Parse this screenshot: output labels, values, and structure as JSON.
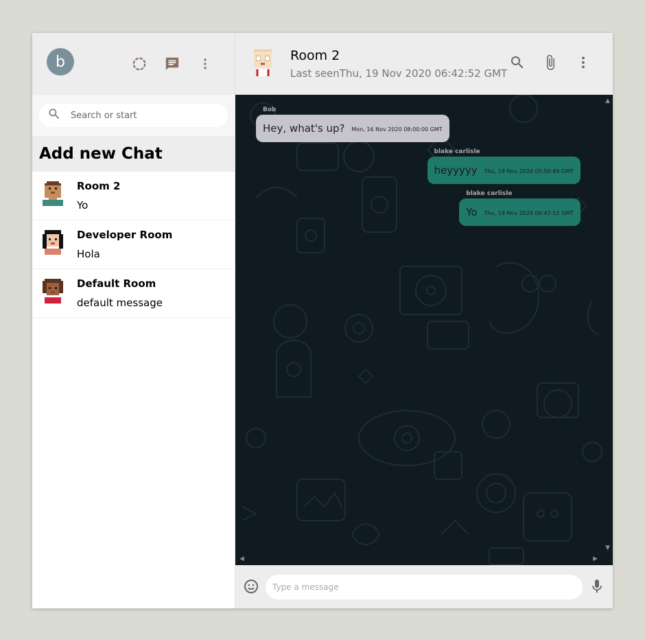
{
  "user": {
    "avatar_letter": "b"
  },
  "sidebar": {
    "search_placeholder": "Search or start",
    "add_chat_label": "Add new Chat",
    "chats": [
      {
        "name": "Room 2",
        "last": "Yo"
      },
      {
        "name": "Developer Room",
        "last": "Hola"
      },
      {
        "name": "Default Room",
        "last": "default message"
      }
    ]
  },
  "chat": {
    "title": "Room 2",
    "last_seen": "Last seenThu, 19 Nov 2020 06:42:52 GMT",
    "messages": [
      {
        "name": "Bob",
        "text": "Hey, what's up?",
        "time": "Mon, 16 Nov 2020 08:00:00 GMT",
        "type": "received"
      },
      {
        "name": "blake carlisle",
        "text": "heyyyyy",
        "time": "Thu, 19 Nov 2020 05:50:49 GMT",
        "type": "sent"
      },
      {
        "name": "blake carlisle",
        "text": "Yo",
        "time": "Thu, 19 Nov 2020 06:42:52 GMT",
        "type": "sent"
      }
    ],
    "input_placeholder": "Type a message"
  },
  "colors": {
    "sent_bubble": "#1f7a6a",
    "received_bubble": "#c6c5cc",
    "chat_background": "#0f1b20",
    "header": "#ededed",
    "avatar_b": "#7b919a"
  },
  "icons": [
    "status-icon",
    "chat-icon",
    "more-vert-icon",
    "search-icon",
    "attach-icon",
    "emoji-icon",
    "mic-icon"
  ]
}
